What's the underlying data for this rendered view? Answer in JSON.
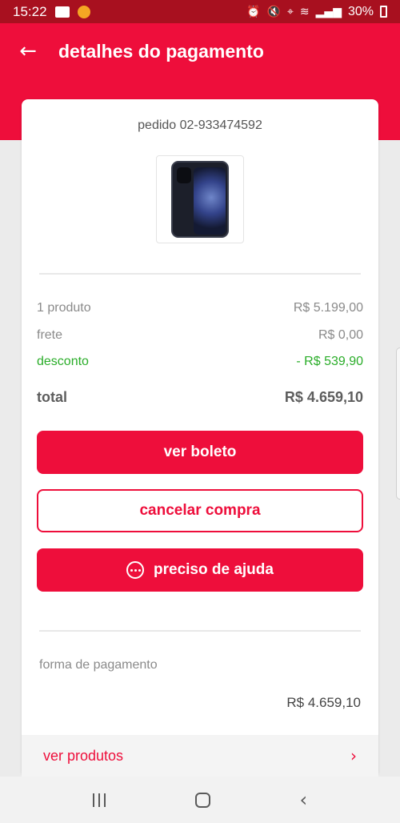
{
  "status_bar": {
    "time": "15:22",
    "battery": "30%"
  },
  "header": {
    "title": "detalhes do pagamento",
    "back_icon": "arrow-left-icon"
  },
  "order": {
    "label": "pedido 02-933474592",
    "product_image": "iphone-12-black"
  },
  "summary": {
    "products_label": "1 produto",
    "products_value": "R$ 5.199,00",
    "shipping_label": "frete",
    "shipping_value": "R$ 0,00",
    "discount_label": "desconto",
    "discount_value": "- R$ 539,90",
    "total_label": "total",
    "total_value": "R$ 4.659,10"
  },
  "buttons": {
    "ver_boleto": "ver boleto",
    "cancelar_compra": "cancelar compra",
    "preciso_de_ajuda": "preciso de ajuda"
  },
  "payment": {
    "label": "forma de pagamento",
    "amount": "R$ 4.659,10"
  },
  "products_link": {
    "label": "ver produtos"
  },
  "colors": {
    "brand_red": "#ee0e3b",
    "status_bar": "#a8101f",
    "discount_green": "#2aad29"
  }
}
